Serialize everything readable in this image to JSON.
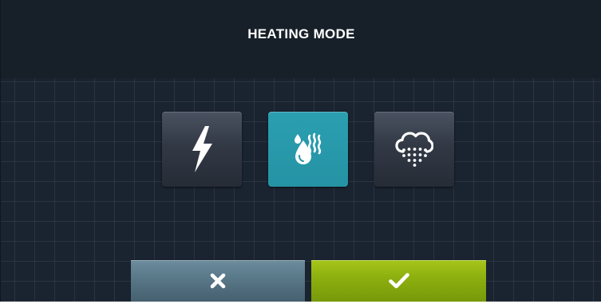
{
  "screen": {
    "title": "HEATING MODE"
  },
  "modes": [
    {
      "id": "electric",
      "icon": "lightning-bolt-icon",
      "selected": false
    },
    {
      "id": "hot-water",
      "icon": "water-drop-heat-icon",
      "selected": true
    },
    {
      "id": "steam",
      "icon": "steam-cloud-icon",
      "selected": false
    }
  ],
  "actions": {
    "cancel_icon": "close-icon",
    "confirm_icon": "checkmark-icon"
  },
  "colors": {
    "background": "#1a2330",
    "selected_mode": "#2a9fb0",
    "unselected_mode": "#323945",
    "cancel_button": "#587787",
    "confirm_button": "#8cae0e",
    "icon": "#ffffff"
  }
}
